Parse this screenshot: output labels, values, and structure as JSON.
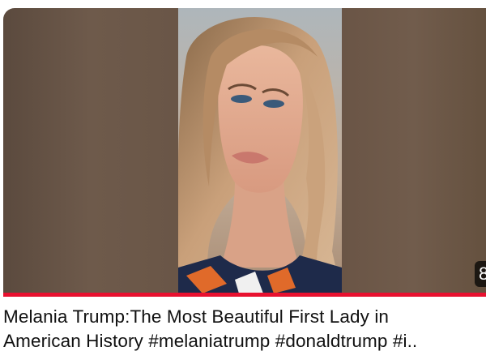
{
  "video": {
    "title_line1": "Melania Trump:The Most Beautiful First Lady in",
    "title_line2": "American History #melaniatrump #donaldtrump #i..",
    "badge_text": "8",
    "progress_fraction": 1.0
  },
  "colors": {
    "progress": "#e8102f",
    "title_text": "#111111"
  },
  "icons": {
    "thumbnail": "portrait-photo"
  }
}
